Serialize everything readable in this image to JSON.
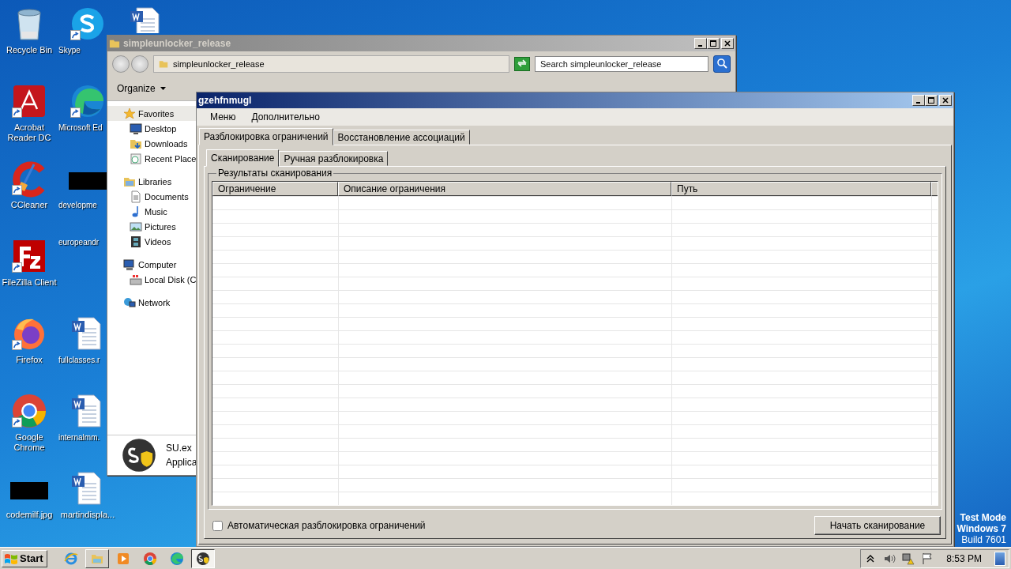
{
  "desktop": {
    "icons": [
      {
        "label": "Recycle Bin",
        "kind": "recycle",
        "shortcut": false
      },
      {
        "label": "Acrobat Reader DC",
        "kind": "acrobat",
        "shortcut": true
      },
      {
        "label": "CCleaner",
        "kind": "ccleaner",
        "shortcut": true
      },
      {
        "label": "FileZilla Client",
        "kind": "filezilla",
        "shortcut": true
      },
      {
        "label": "Firefox",
        "kind": "firefox",
        "shortcut": true
      },
      {
        "label": "Google Chrome",
        "kind": "chrome",
        "shortcut": true
      },
      {
        "label": "codemilf.jpg",
        "kind": "redacted",
        "shortcut": false
      },
      {
        "label": "Skype",
        "kind": "skype",
        "shortcut": true
      },
      {
        "label": "Microsoft Ed",
        "kind": "edge",
        "shortcut": true
      },
      {
        "label": "developme",
        "kind": "redacted",
        "shortcut": false
      },
      {
        "label": "europeandr",
        "kind": "blank",
        "shortcut": false
      },
      {
        "label": "fullclasses.r",
        "kind": "word",
        "shortcut": false
      },
      {
        "label": "internalmm.",
        "kind": "word",
        "shortcut": false
      },
      {
        "label": "martindispla...",
        "kind": "word",
        "shortcut": false
      },
      {
        "kind": "word",
        "shortcut": false
      }
    ],
    "os_watermark": [
      "Test Mode",
      "Windows 7",
      "Build 7601"
    ]
  },
  "explorer_window": {
    "title": "simpleunlocker_release",
    "address": "simpleunlocker_release",
    "search": {
      "placeholder": "Search simpleunlocker_release"
    },
    "toolbar": [
      "Organize"
    ],
    "nav": [
      {
        "label": "Favorites",
        "kind": "star",
        "selected": true,
        "children": [
          {
            "label": "Desktop",
            "kind": "desktop",
            "selected": false
          },
          {
            "label": "Downloads",
            "kind": "downloads",
            "selected": false
          },
          {
            "label": "Recent Place",
            "kind": "recent",
            "selected": false
          }
        ]
      },
      {
        "label": "Libraries",
        "kind": "libraries",
        "selected": false,
        "children": [
          {
            "label": "Documents",
            "kind": "documents",
            "selected": false
          },
          {
            "label": "Music",
            "kind": "music",
            "selected": false
          },
          {
            "label": "Pictures",
            "kind": "pictures",
            "selected": false
          },
          {
            "label": "Videos",
            "kind": "videos",
            "selected": false
          }
        ]
      },
      {
        "label": "Computer",
        "kind": "computer",
        "selected": false,
        "children": [
          {
            "label": "Local Disk (C",
            "kind": "disk",
            "selected": false
          }
        ]
      },
      {
        "label": "Network",
        "kind": "network",
        "selected": false
      }
    ],
    "details": {
      "name": "SU.ex",
      "type": "Applica"
    }
  },
  "app_window": {
    "title": "gzehfnmugl",
    "menu": [
      "Меню",
      "Дополнительно"
    ],
    "tabs": [
      {
        "label": "Разблокировка ограничений",
        "selected": true
      },
      {
        "label": "Восстановление ассоциаций",
        "selected": false
      }
    ],
    "subtabs": [
      {
        "label": "Сканирование",
        "selected": true
      },
      {
        "label": "Ручная разблокировка",
        "selected": false
      }
    ],
    "group": {
      "title": "Результаты сканирования",
      "columns": [
        "Ограничение",
        "Описание ограничения",
        "Путь"
      ]
    },
    "auto_unlock": {
      "label": "Автоматическая разблокировка ограничений",
      "checked": false
    },
    "scan_button": "Начать сканирование"
  },
  "taskbar": {
    "start": "Start",
    "apps": [
      {
        "kind": "ie",
        "open": false,
        "selected": false
      },
      {
        "kind": "explorer",
        "open": true,
        "selected": false
      },
      {
        "kind": "media",
        "open": false,
        "selected": false
      },
      {
        "kind": "chrome",
        "open": false,
        "selected": false
      },
      {
        "kind": "edge",
        "open": false,
        "selected": false
      },
      {
        "kind": "su",
        "open": true,
        "selected": true
      }
    ],
    "time": "8:53 PM"
  }
}
